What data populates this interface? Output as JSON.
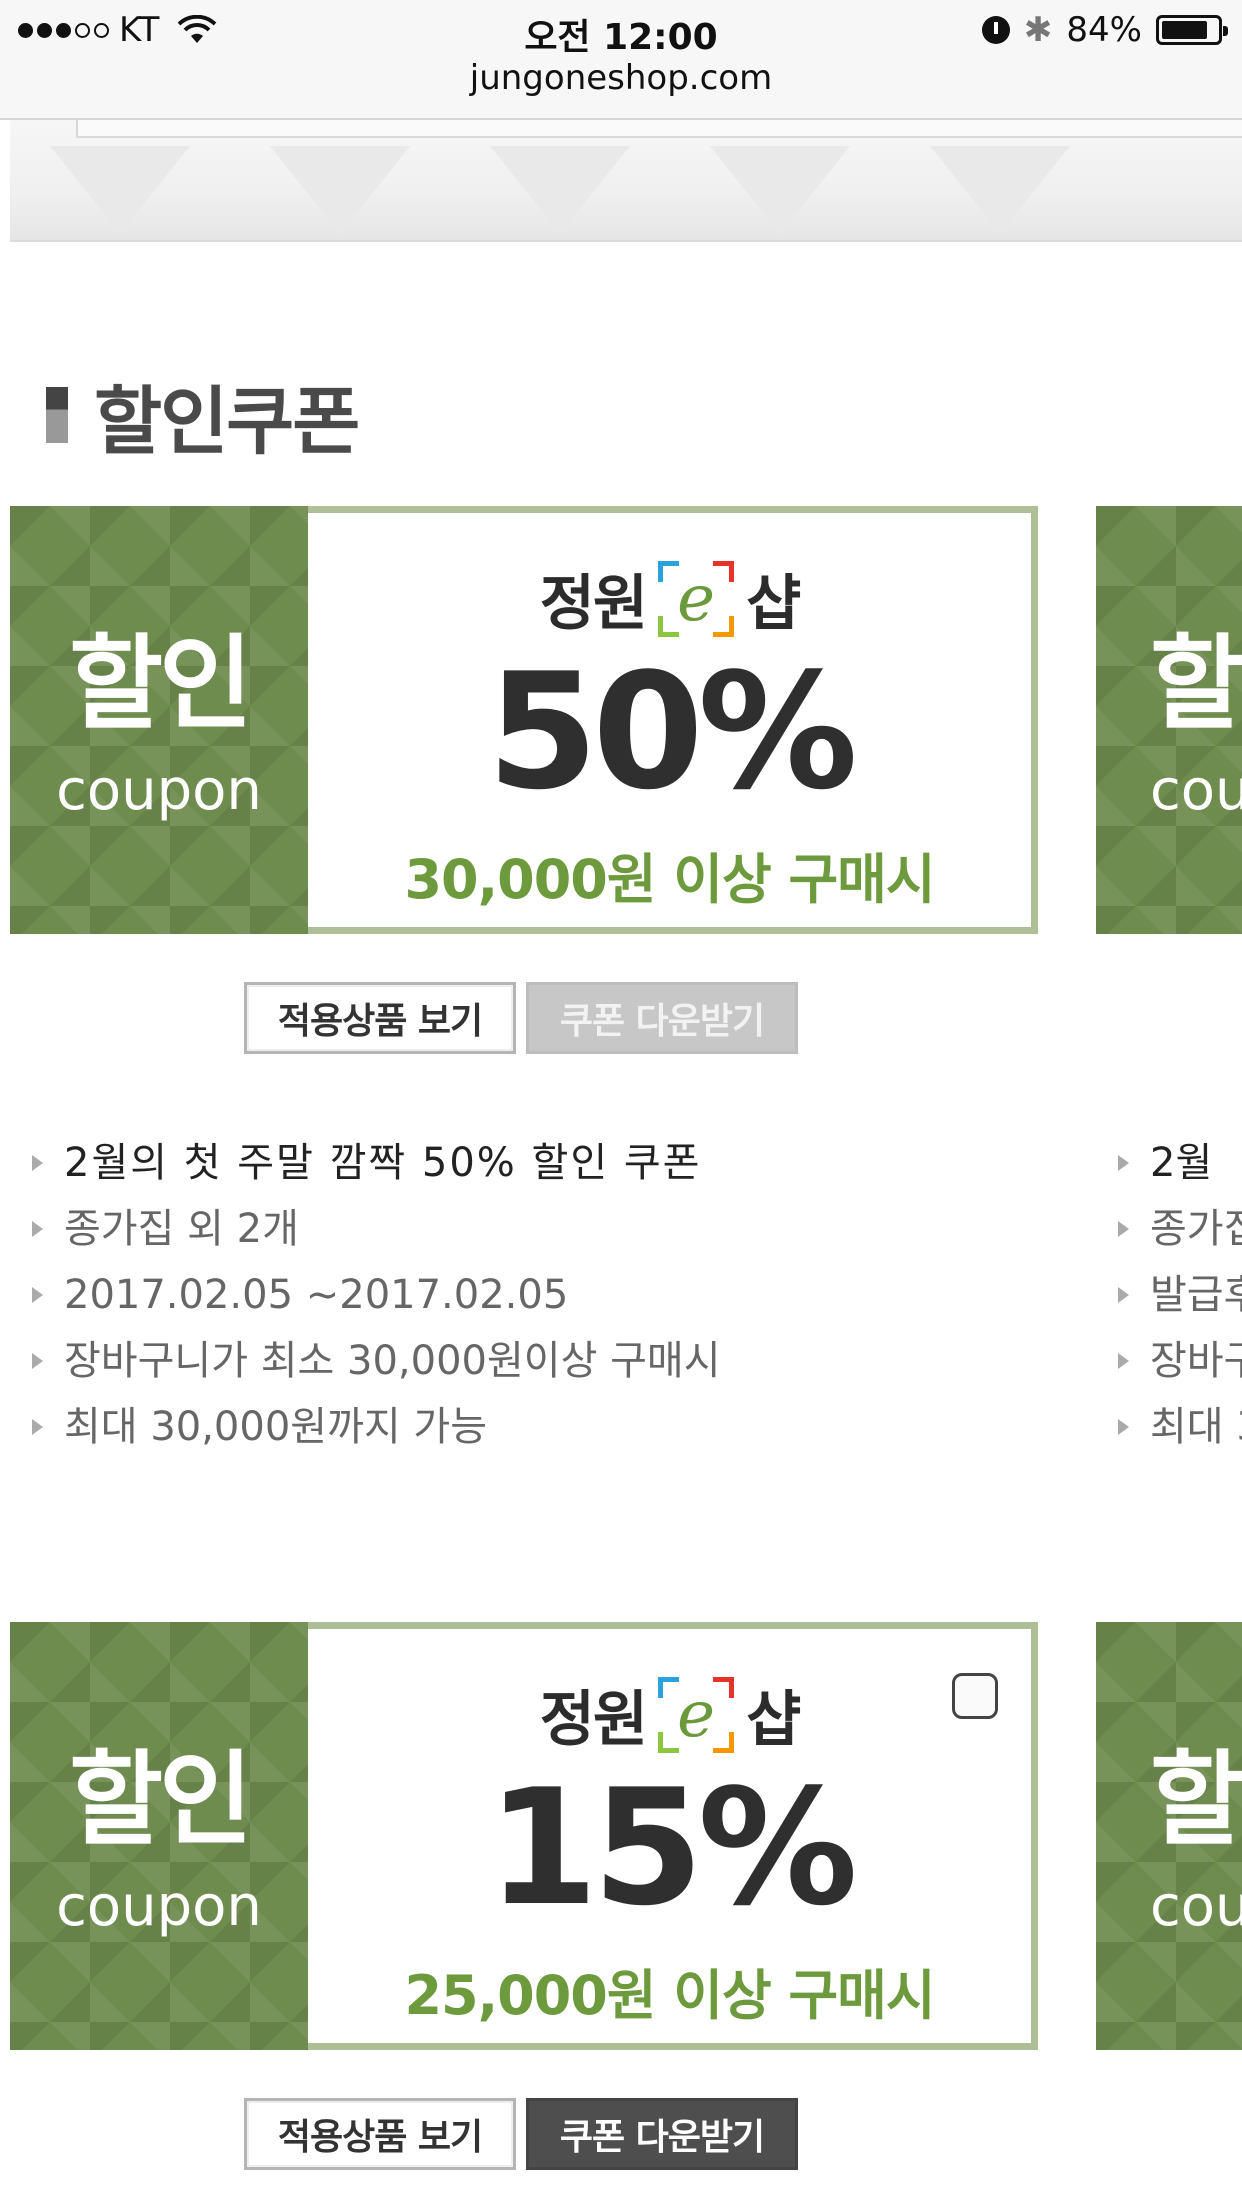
{
  "status_bar": {
    "carrier": "KT",
    "time": "오전 12:00",
    "battery": "84%",
    "battery_level": 0.84,
    "url": "jungoneshop.com"
  },
  "section": {
    "title": "할인쿠폰"
  },
  "coupons": [
    {
      "left_big": "할인",
      "left_small": "coupon",
      "brand_left": "정원",
      "brand_e": "e",
      "brand_right": "샵",
      "rate": "50%",
      "condition": "30,000원 이상 구매시",
      "view_button": "적용상품 보기",
      "download_button": "쿠폰 다운받기",
      "download_state": "disabled",
      "info": [
        "2월의 첫 주말 깜짝 50% 할인 쿠폰",
        "종가집 외 2개",
        "2017.02.05 ~2017.02.05",
        "장바구니가 최소 30,000원이상 구매시",
        "최대 30,000원까지 가능"
      ]
    },
    {
      "left_big": "할인",
      "left_small": "coupon",
      "brand_left": "정원",
      "brand_e": "e",
      "brand_right": "샵",
      "rate": "15%",
      "condition": "25,000원 이상 구매시",
      "view_button": "적용상품 보기",
      "download_button": "쿠폰 다운받기",
      "download_state": "active"
    }
  ],
  "peek_column": {
    "card1": {
      "left_big": "할",
      "left_small": "cou"
    },
    "card2": {
      "left_big": "할",
      "left_small": "cou"
    },
    "info": [
      "2월 ",
      "종가집",
      "발급후",
      "장바구",
      "최대 3"
    ]
  },
  "colors": {
    "coupon_green": "#6f8c4f",
    "condition_green": "#6d9a3c",
    "card_border": "#aebf98"
  }
}
